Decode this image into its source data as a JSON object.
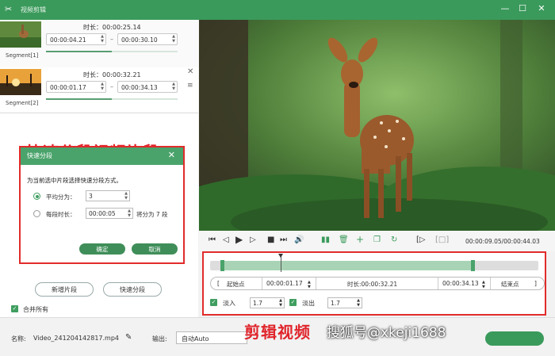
{
  "titlebar": {
    "app_title": "视频剪辑",
    "min": "—",
    "max": "☐",
    "close": "✕"
  },
  "segments": [
    {
      "label": "Segment[1]",
      "duration": "时长：00:00:25.14",
      "start": "00:00:04.21",
      "end": "00:00:30.10",
      "progress": 0.5
    },
    {
      "label": "Segment[2]",
      "duration": "时长：00:00:32.21",
      "start": "00:00:01.17",
      "end": "00:00:34.13",
      "progress": 0.5
    }
  ],
  "annotations": {
    "left_title": "快速分段视频片段",
    "bottom_title": "剪辑视频",
    "watermark": "搜狐号@xkeji1688"
  },
  "dialog": {
    "title": "快速分段",
    "question": "为当前选中片段选择快速分段方式。",
    "option1_label": "平均分为：",
    "option1_value": "3",
    "option2_label": "每段时长：",
    "option2_value": "00:00:05",
    "option2_hint": "将分为 7 段",
    "ok": "确定",
    "cancel": "取消"
  },
  "left_actions": {
    "new_segment": "新增片段",
    "quick_split": "快速分段",
    "merge_all": "合并所有"
  },
  "player": {
    "time": "00:00:09.05/00:00:44.03",
    "playhead_fraction": 0.2
  },
  "editor": {
    "start_btn": "起始点",
    "start_value": "00:00:01.17",
    "duration": "时长:00:00:32.21",
    "end_value": "00:00:34.13",
    "end_btn": "结束点",
    "fade_in_label": "淡入",
    "fade_in_value": "1.7",
    "fade_out_label": "淡出",
    "fade_out_value": "1.7"
  },
  "bottom": {
    "name_label": "名称:",
    "file_name": "Video_241204142817.mp4",
    "output_label": "输出:",
    "output_value": "自动Auto"
  },
  "colors": {
    "brand_green": "#3a9a5b",
    "annotation_red": "#e0242b"
  }
}
